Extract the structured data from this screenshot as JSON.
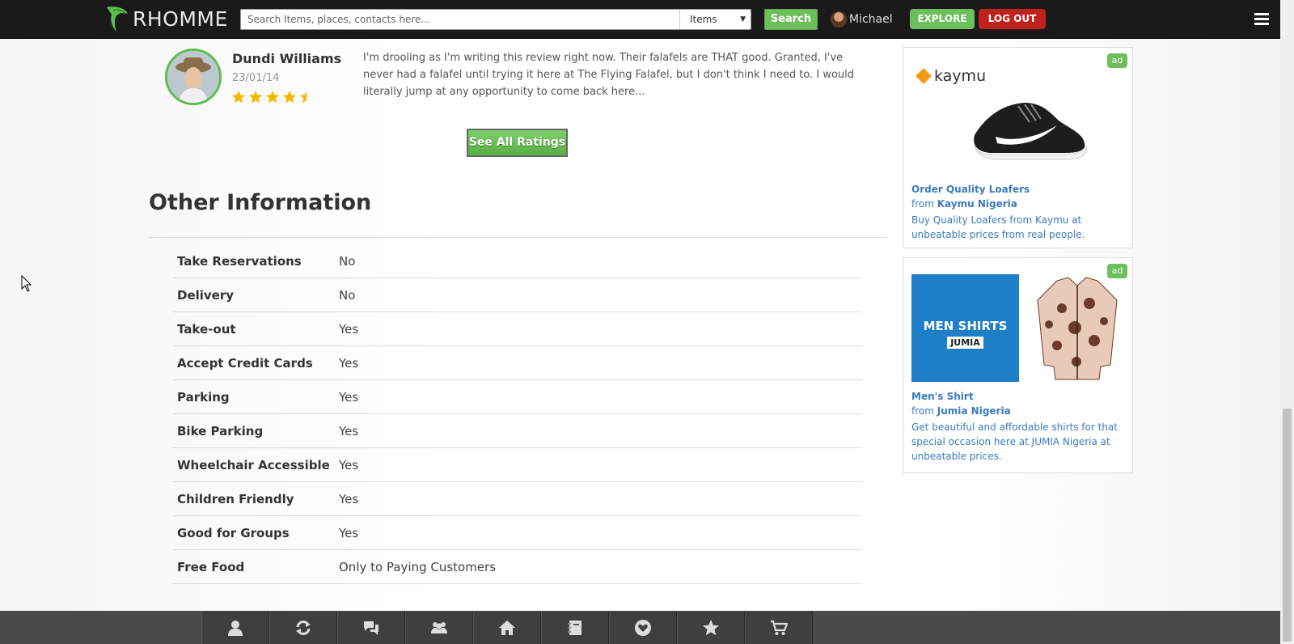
{
  "header": {
    "brand": "RHOMME",
    "search_placeholder": "Search Items, places, contacts here...",
    "search_category": "Items",
    "search_button": "Search",
    "user_name": "Michael",
    "explore_button": "EXPLORE",
    "logout_button": "LOG OUT"
  },
  "review": {
    "name": "Dundi Williams",
    "date": "23/01/14",
    "rating": 4.5,
    "text": "I'm drooling as I'm writing this review right now. Their falafels are THAT good. Granted, I've never had a falafel until trying it here at The Flying Falafel, but I don't think I need to. I would literally jump at any opportunity to come back here..."
  },
  "see_all_ratings": "See All Ratings",
  "other_info": {
    "title": "Other Information",
    "rows": [
      {
        "key": "Take Reservations",
        "value": "No"
      },
      {
        "key": "Delivery",
        "value": "No"
      },
      {
        "key": "Take-out",
        "value": "Yes"
      },
      {
        "key": "Accept Credit Cards",
        "value": "Yes"
      },
      {
        "key": "Parking",
        "value": "Yes"
      },
      {
        "key": "Bike Parking",
        "value": "Yes"
      },
      {
        "key": "Wheelchair Accessible",
        "value": "Yes"
      },
      {
        "key": "Children Friendly",
        "value": "Yes"
      },
      {
        "key": "Good for Groups",
        "value": "Yes"
      },
      {
        "key": "Free Food",
        "value": "Only to Paying Customers"
      }
    ]
  },
  "ads": [
    {
      "badge": "ad",
      "logo_text": "kaymu",
      "title": "Order Quality Loafers",
      "from_label": "from",
      "vendor": "Kaymu Nigeria",
      "description": "Buy Quality Loafers from Kaymu at unbeatable prices from real people."
    },
    {
      "badge": "ad",
      "banner_text": "MEN SHIRTS",
      "banner_brand": "JUMIA",
      "title": "Men's Shirt",
      "from_label": "from",
      "vendor": "Jumia Nigeria",
      "description": "Get beautiful and affordable shirts for that special occasion here at JUMIA Nigeria at unbeatable prices."
    }
  ],
  "bottom_nav": [
    "user-icon",
    "refresh-icon",
    "chat-icon",
    "group-icon",
    "home-icon",
    "notebook-icon",
    "heart-icon",
    "star-icon",
    "cart-icon"
  ],
  "colors": {
    "accent_green": "#6cbf5a",
    "logout_red": "#c0211b",
    "link_blue": "#3a7bbf",
    "star_gold": "#f5b800"
  }
}
